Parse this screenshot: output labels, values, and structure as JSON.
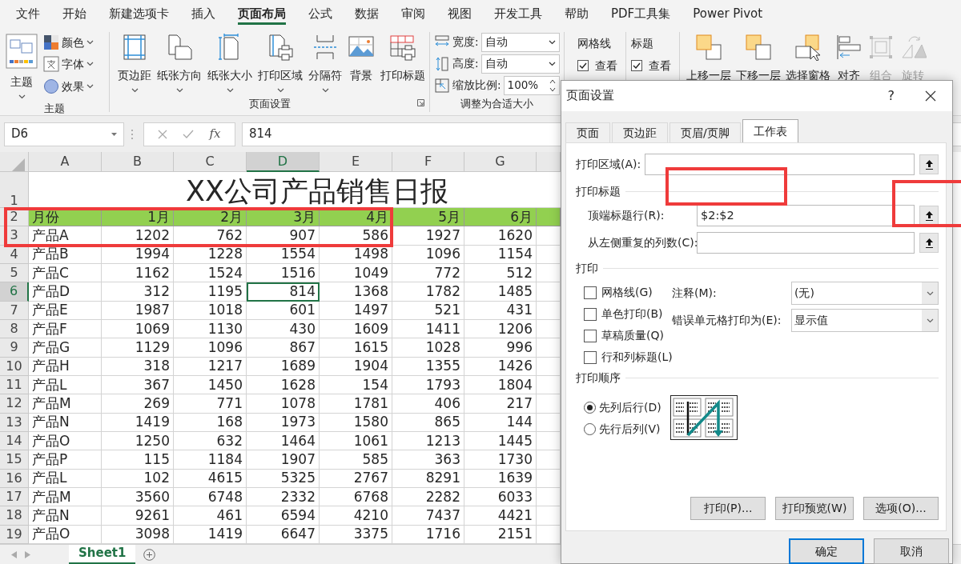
{
  "menu_tabs": [
    {
      "label": "文件",
      "selected": false
    },
    {
      "label": "开始",
      "selected": false
    },
    {
      "label": "新建选项卡",
      "selected": false
    },
    {
      "label": "插入",
      "selected": false
    },
    {
      "label": "页面布局",
      "selected": true
    },
    {
      "label": "公式",
      "selected": false
    },
    {
      "label": "数据",
      "selected": false
    },
    {
      "label": "审阅",
      "selected": false
    },
    {
      "label": "视图",
      "selected": false
    },
    {
      "label": "开发工具",
      "selected": false
    },
    {
      "label": "帮助",
      "selected": false
    },
    {
      "label": "PDF工具集",
      "selected": false
    },
    {
      "label": "Power Pivot",
      "selected": false
    }
  ],
  "theme_group": {
    "label": "主题",
    "main_button": "主题",
    "items": [
      {
        "label": "颜色"
      },
      {
        "label": "字体"
      },
      {
        "label": "效果"
      }
    ]
  },
  "page_setup_group": {
    "label": "页面设置",
    "buttons": [
      {
        "label": "页边距",
        "dropdown": true
      },
      {
        "label": "纸张方向",
        "dropdown": true
      },
      {
        "label": "纸张大小",
        "dropdown": true
      },
      {
        "label": "打印区域",
        "dropdown": true
      },
      {
        "label": "分隔符",
        "dropdown": true
      },
      {
        "label": "背景",
        "dropdown": false
      },
      {
        "label": "打印标题",
        "dropdown": false
      }
    ]
  },
  "scale_group": {
    "label": "调整为合适大小",
    "rows": [
      {
        "label": "宽度:",
        "value": "自动",
        "kind": "select"
      },
      {
        "label": "高度:",
        "value": "自动",
        "kind": "select"
      },
      {
        "label": "缩放比例:",
        "value": "100%",
        "kind": "spin"
      }
    ]
  },
  "sheet_options": [
    {
      "title": "网格线",
      "checkbox": {
        "label": "查看",
        "checked": true
      }
    },
    {
      "title": "标题",
      "checkbox": {
        "label": "查看",
        "checked": true
      }
    }
  ],
  "arrange_group": {
    "buttons": [
      {
        "label": "上移一层",
        "disabled": false
      },
      {
        "label": "下移一层",
        "disabled": false
      },
      {
        "label": "选择窗格",
        "disabled": false
      },
      {
        "label": "对齐",
        "disabled": false
      },
      {
        "label": "组合",
        "disabled": true
      },
      {
        "label": "旋转",
        "disabled": true
      }
    ]
  },
  "formula_bar": {
    "name_box": "D6",
    "function_symbol": "fx",
    "formula": "814"
  },
  "sheet": {
    "columns": [
      {
        "label": "A",
        "selected": false
      },
      {
        "label": "B",
        "selected": false
      },
      {
        "label": "C",
        "selected": false
      },
      {
        "label": "D",
        "selected": true
      },
      {
        "label": "E",
        "selected": false
      },
      {
        "label": "F",
        "selected": false
      },
      {
        "label": "G",
        "selected": false
      }
    ],
    "title_row": {
      "number": "1",
      "title": "XX公司产品销售日报"
    },
    "header_row": {
      "number": "2",
      "cells": [
        "月份",
        "1月",
        "2月",
        "3月",
        "4月",
        "5月",
        "6月"
      ]
    },
    "rows": [
      {
        "number": "3",
        "selected": false,
        "cells": [
          "产品A",
          "1202",
          "762",
          "907",
          "586",
          "1927",
          "1620"
        ]
      },
      {
        "number": "4",
        "selected": false,
        "cells": [
          "产品B",
          "1994",
          "1228",
          "1554",
          "1498",
          "1096",
          "1154"
        ]
      },
      {
        "number": "5",
        "selected": false,
        "cells": [
          "产品C",
          "1162",
          "1524",
          "1516",
          "1049",
          "772",
          "512"
        ]
      },
      {
        "number": "6",
        "selected": true,
        "cells": [
          "产品D",
          "312",
          "1195",
          "814",
          "1368",
          "1782",
          "1485"
        ]
      },
      {
        "number": "7",
        "selected": false,
        "cells": [
          "产品E",
          "1987",
          "1018",
          "601",
          "1497",
          "521",
          "431"
        ]
      },
      {
        "number": "8",
        "selected": false,
        "cells": [
          "产品F",
          "1069",
          "1130",
          "430",
          "1609",
          "1411",
          "1206"
        ]
      },
      {
        "number": "9",
        "selected": false,
        "cells": [
          "产品G",
          "1129",
          "1096",
          "867",
          "1615",
          "1028",
          "996"
        ]
      },
      {
        "number": "10",
        "selected": false,
        "cells": [
          "产品H",
          "318",
          "1217",
          "1689",
          "1904",
          "1355",
          "1426"
        ]
      },
      {
        "number": "11",
        "selected": false,
        "cells": [
          "产品L",
          "367",
          "1450",
          "1628",
          "154",
          "1793",
          "1804"
        ]
      },
      {
        "number": "12",
        "selected": false,
        "cells": [
          "产品M",
          "269",
          "771",
          "1078",
          "1781",
          "406",
          "217"
        ]
      },
      {
        "number": "13",
        "selected": false,
        "cells": [
          "产品N",
          "1419",
          "168",
          "1973",
          "1580",
          "865",
          "144"
        ]
      },
      {
        "number": "14",
        "selected": false,
        "cells": [
          "产品O",
          "1250",
          "632",
          "1464",
          "1061",
          "1213",
          "1445"
        ]
      },
      {
        "number": "15",
        "selected": false,
        "cells": [
          "产品P",
          "115",
          "1184",
          "1907",
          "585",
          "363",
          "1730"
        ]
      },
      {
        "number": "16",
        "selected": false,
        "cells": [
          "产品L",
          "102",
          "4615",
          "5325",
          "2767",
          "8291",
          "1639"
        ]
      },
      {
        "number": "17",
        "selected": false,
        "cells": [
          "产品M",
          "3560",
          "6748",
          "2332",
          "6768",
          "2282",
          "6033"
        ]
      },
      {
        "number": "18",
        "selected": false,
        "cells": [
          "产品N",
          "9261",
          "461",
          "6594",
          "4210",
          "7437",
          "4421"
        ]
      },
      {
        "number": "19",
        "selected": false,
        "cells": [
          "产品O",
          "3098",
          "1419",
          "6647",
          "3375",
          "1716",
          "2151"
        ]
      }
    ]
  },
  "sheet_tabs": [
    {
      "label": "Sheet1",
      "selected": true
    }
  ],
  "dialog": {
    "title": "页面设置",
    "help": "?",
    "tabs": [
      {
        "label": "页面",
        "selected": false
      },
      {
        "label": "页边距",
        "selected": false
      },
      {
        "label": "页眉/页脚",
        "selected": false
      },
      {
        "label": "工作表",
        "selected": true
      }
    ],
    "print_area": {
      "label": "打印区域(A):"
    },
    "print_titles": {
      "heading": "打印标题",
      "rows": [
        {
          "label": "顶端标题行(R):",
          "value": "$2:$2"
        },
        {
          "label": "从左侧重复的列数(C):"
        }
      ]
    },
    "print": {
      "heading": "打印",
      "options": [
        {
          "label": "网格线(G)",
          "checked": false
        },
        {
          "label": "单色打印(B)",
          "checked": false
        },
        {
          "label": "草稿质量(Q)",
          "checked": false
        },
        {
          "label": "行和列标题(L)",
          "checked": false
        }
      ],
      "selects": [
        {
          "label": "注释(M):",
          "value": "(无)"
        },
        {
          "label": "错误单元格打印为(E):",
          "value": "显示值"
        }
      ]
    },
    "order": {
      "heading": "打印顺序",
      "options": [
        {
          "label": "先列后行(D)",
          "selected": true
        },
        {
          "label": "先行后列(V)",
          "selected": false
        }
      ]
    },
    "buttons": [
      "打印(P)...",
      "打印预览(W)",
      "选项(O)..."
    ],
    "footer_buttons": [
      {
        "label": "确定",
        "default": true
      },
      {
        "label": "取消",
        "default": false
      }
    ]
  }
}
